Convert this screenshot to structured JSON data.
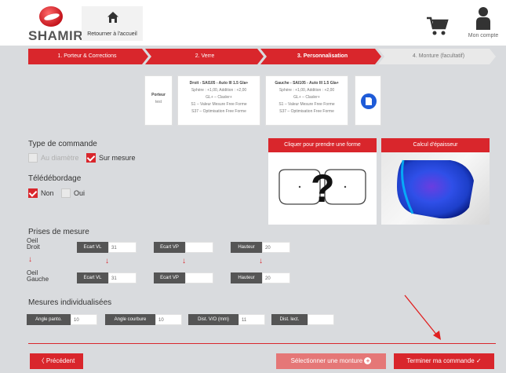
{
  "header": {
    "logo_text": "SHAMIR",
    "home_label": "Retourner à l'accueil",
    "account_label": "Mon compte"
  },
  "steps": [
    {
      "label": "1. Porteur & Corrections",
      "state": "done"
    },
    {
      "label": "2. Verre",
      "state": "done"
    },
    {
      "label": "3. Personnalisation",
      "state": "active"
    },
    {
      "label": "4. Monture (facultatif)",
      "state": "todo"
    }
  ],
  "wearer_card": {
    "title": "Porteur",
    "name": "test"
  },
  "right_lens": {
    "title": "Droit - SAI105 - Auto III 1.5 Gla+",
    "sphere": "Sphère : +1,00, Addition : +2,00",
    "coating": "GL+ – Clasler+",
    "s1": "S1 – Valeur Mesure Free Forme",
    "s2": "S37 – Optimisation Free Forme"
  },
  "left_lens": {
    "title": "Gauche - SAI105 - Auto III 1.5 Gla+",
    "sphere": "Sphère : +1,00, Addition : +2,00",
    "coating": "GL+ – Clasler+",
    "s1": "S1 – Valeur Mesure Free Forme",
    "s2": "S37 – Optimisation Free Forme"
  },
  "order_type": {
    "title": "Type de commande",
    "opt1": "Au diamètre",
    "opt2": "Sur mesure"
  },
  "edging": {
    "title": "Télédébordage",
    "opt1": "Non",
    "opt2": "Oui"
  },
  "panels": {
    "shape": "Cliquer pour prendre une forme",
    "thickness": "Calcul d'épaisseur",
    "question_mark": "?"
  },
  "measures": {
    "title": "Prises de mesure",
    "right_eye_1": "Oeil",
    "right_eye_2": "Droit",
    "left_eye_1": "Oeil",
    "left_eye_2": "Gauche",
    "ecart_vl": "Ecart VL",
    "ecart_vp": "Ecart VP",
    "hauteur": "Hauteur",
    "right": {
      "vl": "31",
      "vp": "",
      "h": "20"
    },
    "left": {
      "vl": "31",
      "vp": "",
      "h": "20"
    }
  },
  "individual": {
    "title": "Mesures individualisées",
    "angle_panto": "Angle panto.",
    "angle_panto_val": "10",
    "angle_courbure": "Angle courbure",
    "angle_courbure_val": "10",
    "dist_vo": "Dist. V/O (mm)",
    "dist_vo_val": "11",
    "dist_lect": "Dist. lect.",
    "dist_lect_val": ""
  },
  "footer": {
    "prev": "Précédent",
    "select_frame": "Sélectionner une monture",
    "finish": "Terminer ma commande"
  },
  "colors": {
    "accent": "#d9262c",
    "label_bg": "#555555",
    "step_todo": "#e9e9e9"
  }
}
